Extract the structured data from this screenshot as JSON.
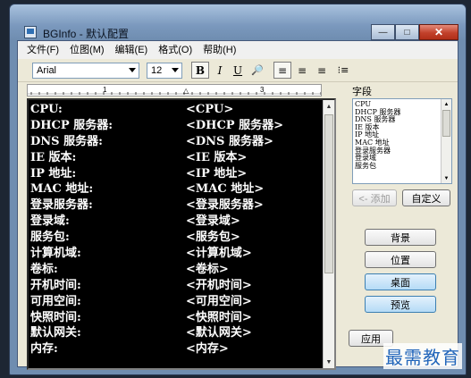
{
  "window": {
    "title": "BGInfo - 默认配置",
    "minimize_glyph": "—",
    "maximize_glyph": "□",
    "close_glyph": "✕"
  },
  "menu": [
    "文件(F)",
    "位图(M)",
    "编辑(E)",
    "格式(O)",
    "帮助(H)"
  ],
  "toolbar": {
    "font": "Arial",
    "size": "12",
    "bold": "B",
    "italic": "I",
    "underline": "U",
    "color_glyph": "🔎",
    "align_left": "≡",
    "align_center": "≡",
    "align_right": "≡",
    "bullets": "⁝≡"
  },
  "editor_rows": [
    {
      "label": "CPU:",
      "value": "<CPU>"
    },
    {
      "label": "DHCP 服务器:",
      "value": "<DHCP 服务器>"
    },
    {
      "label": "DNS 服务器:",
      "value": "<DNS 服务器>"
    },
    {
      "label": "IE 版本:",
      "value": "<IE 版本>"
    },
    {
      "label": "IP 地址:",
      "value": "<IP 地址>"
    },
    {
      "label": "MAC 地址:",
      "value": "<MAC 地址>"
    },
    {
      "label": "登录服务器:",
      "value": "<登录服务器>"
    },
    {
      "label": "登录域:",
      "value": "<登录域>"
    },
    {
      "label": "服务包:",
      "value": "<服务包>"
    },
    {
      "label": "计算机域:",
      "value": "<计算机域>"
    },
    {
      "label": "卷标:",
      "value": "<卷标>"
    },
    {
      "label": "开机时间:",
      "value": "<开机时间>"
    },
    {
      "label": "可用空间:",
      "value": "<可用空间>"
    },
    {
      "label": "快照时间:",
      "value": "<快照时间>"
    },
    {
      "label": "默认网关:",
      "value": "<默认网关>"
    },
    {
      "label": "内存:",
      "value": "<内存>"
    }
  ],
  "fields": {
    "label": "字段",
    "items": [
      "CPU",
      "DHCP 服务器",
      "DNS 服务器",
      "IE 版本",
      "IP 地址",
      "MAC 地址",
      "登录服务器",
      "登录域",
      "服务包"
    ],
    "add_button": "<- 添加",
    "custom_button": "自定义"
  },
  "buttons": {
    "background": "背景",
    "position": "位置",
    "desktop": "桌面",
    "preview": "预览",
    "apply": "应用"
  },
  "watermark": "最需教育"
}
